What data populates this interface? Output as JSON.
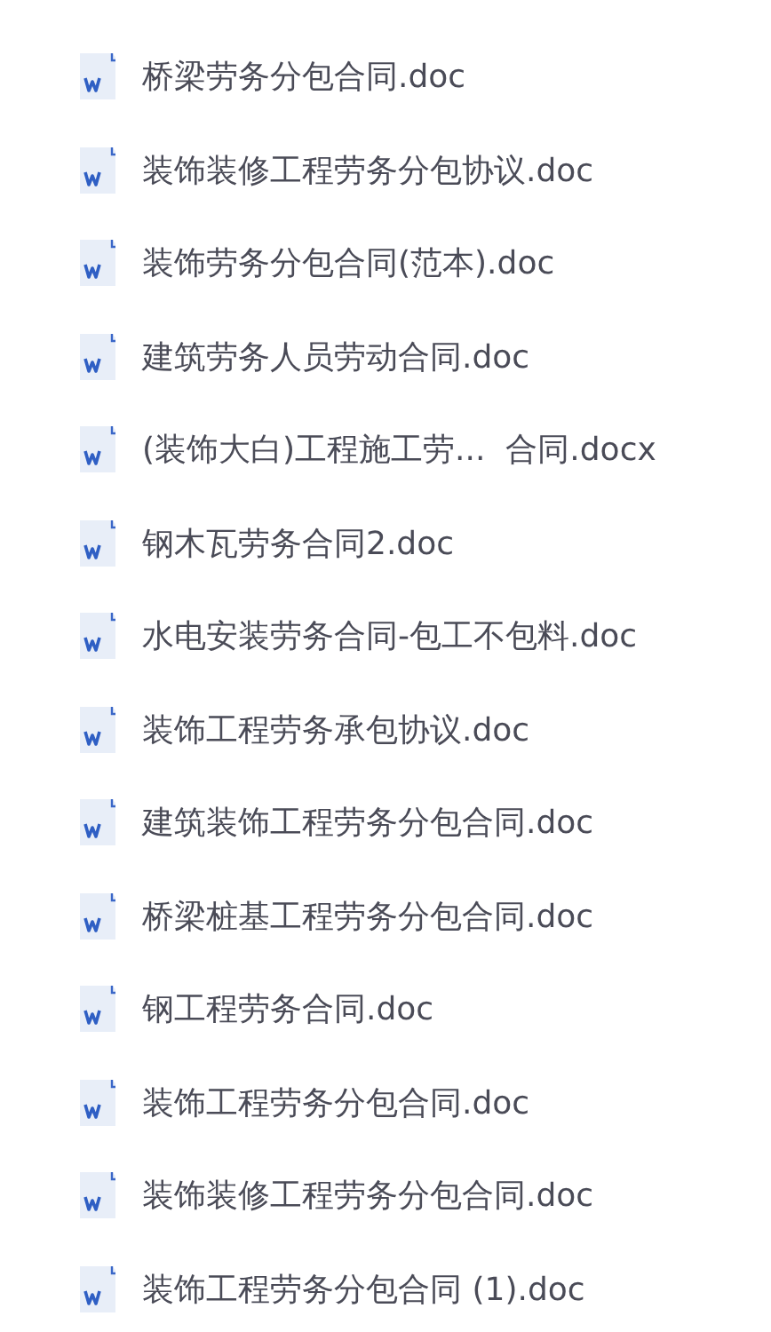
{
  "files": [
    {
      "name": "桥梁劳务分包合同.doc"
    },
    {
      "name": "装饰装修工程劳务分包协议.doc"
    },
    {
      "name": "装饰劳务分包合同(范本).doc"
    },
    {
      "name": "建筑劳务人员劳动合同.doc"
    },
    {
      "name": "(装饰大白)工程施工劳...  合同.docx"
    },
    {
      "name": "钢木瓦劳务合同2.doc"
    },
    {
      "name": "水电安装劳务合同-包工不包料.doc"
    },
    {
      "name": "装饰工程劳务承包协议.doc"
    },
    {
      "name": "建筑装饰工程劳务分包合同.doc"
    },
    {
      "name": "桥梁桩基工程劳务分包合同.doc"
    },
    {
      "name": "钢工程劳务合同.doc"
    },
    {
      "name": "装饰工程劳务分包合同.doc"
    },
    {
      "name": "装饰装修工程劳务分包合同.doc"
    },
    {
      "name": "装饰工程劳务分包合同 (1).doc"
    }
  ]
}
